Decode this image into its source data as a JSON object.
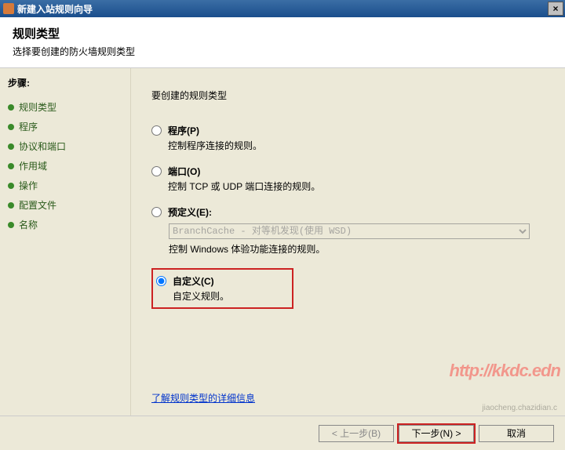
{
  "window": {
    "title": "新建入站规则向导",
    "close": "×"
  },
  "header": {
    "title": "规则类型",
    "subtitle": "选择要创建的防火墙规则类型"
  },
  "sidebar": {
    "steps_label": "步骤:",
    "items": [
      {
        "label": "规则类型"
      },
      {
        "label": "程序"
      },
      {
        "label": "协议和端口"
      },
      {
        "label": "作用域"
      },
      {
        "label": "操作"
      },
      {
        "label": "配置文件"
      },
      {
        "label": "名称"
      }
    ]
  },
  "content": {
    "question": "要创建的规则类型",
    "options": [
      {
        "title": "程序(P)",
        "desc": "控制程序连接的规则。",
        "checked": false
      },
      {
        "title": "端口(O)",
        "desc": "控制 TCP 或 UDP 端口连接的规则。",
        "checked": false
      }
    ],
    "predefined": {
      "title": "预定义(E):",
      "select_value": "BranchCache - 对等机发现(使用 WSD)",
      "desc": "控制 Windows 体验功能连接的规则。",
      "checked": false
    },
    "custom": {
      "title": "自定义(C)",
      "desc": "自定义规则。",
      "checked": true
    },
    "link": "了解规则类型的详细信息"
  },
  "footer": {
    "back": "< 上一步(B)",
    "next": "下一步(N) >",
    "cancel": "取消"
  },
  "watermark": {
    "main": "http://kkdc.edn",
    "sub": "jiaocheng.chazidian.c"
  }
}
